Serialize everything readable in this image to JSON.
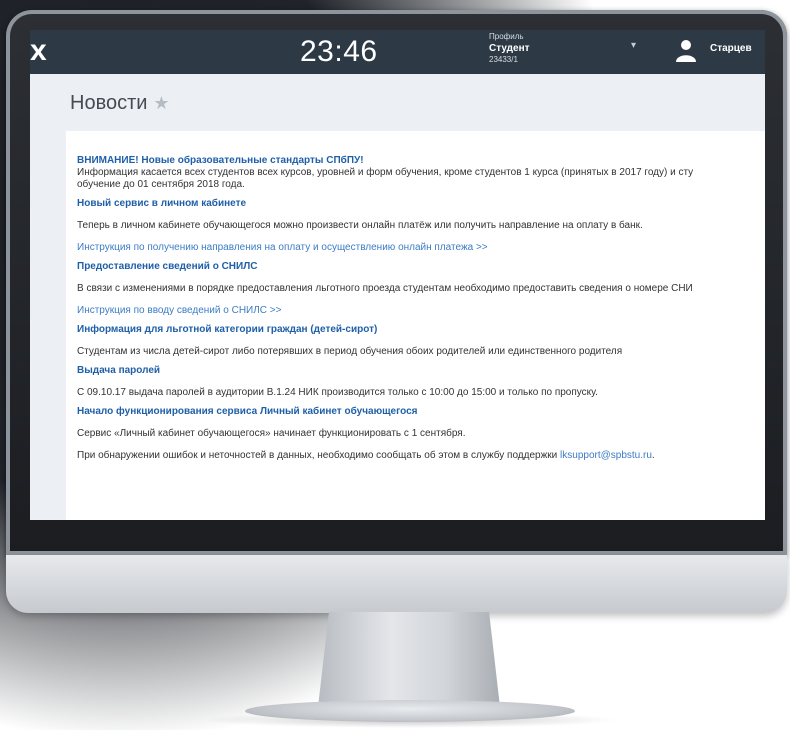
{
  "topbar": {
    "close_label": "x",
    "clock": "23:46",
    "profile_caption": "Профиль",
    "profile_role": "Студент",
    "profile_id": "23433/1",
    "caret": "▾",
    "user_name": "Старцев"
  },
  "page": {
    "title": "Новости",
    "star": "★"
  },
  "news": [
    {
      "title": "ВНИМАНИЕ! Новые образовательные стандарты СПбПУ!",
      "text_line1": "Информация касается всех студентов всех курсов, уровней и форм обучения, кроме студентов 1 курса (принятых в 2017 году) и сту",
      "text_line2": "обучение до 01 сентября 2018 года."
    },
    {
      "title": "Новый сервис в личном кабинете",
      "text": "Теперь в личном кабинете обучающегося можно произвести онлайн платёж или получить направление на оплату в банк.",
      "link": "Инструкция по получению направления на оплату и осуществлению онлайн платежа >>"
    },
    {
      "title": "Предоставление сведений о СНИЛС",
      "text": "В связи с изменениями в порядке предоставления льготного проезда студентам необходимо предоставить сведения о номере СНИ",
      "link": "Инструкция по вводу сведений о СНИЛС >>"
    },
    {
      "title": "Информация для льготной категории граждан (детей-сирот)",
      "text": "Студентам из числа детей-сирот либо потерявших в период обучения обоих родителей или единственного родителя"
    },
    {
      "title": "Выдача паролей",
      "text": "С 09.10.17 выдача паролей в аудитории В.1.24 НИК производится только с 10:00 до 15:00 и только по пропуску."
    },
    {
      "title": "Начало функционирования сервиса Личный кабинет обучающегося",
      "text": "Сервис «Личный кабинет обучающегося» начинает функционировать с 1 сентября.",
      "text2_prefix": "При обнаружении ошибок и неточностей в данных, необходимо сообщать об этом в службу поддержки ",
      "email": "lksupport@spbstu.ru",
      "text2_suffix": "."
    }
  ]
}
